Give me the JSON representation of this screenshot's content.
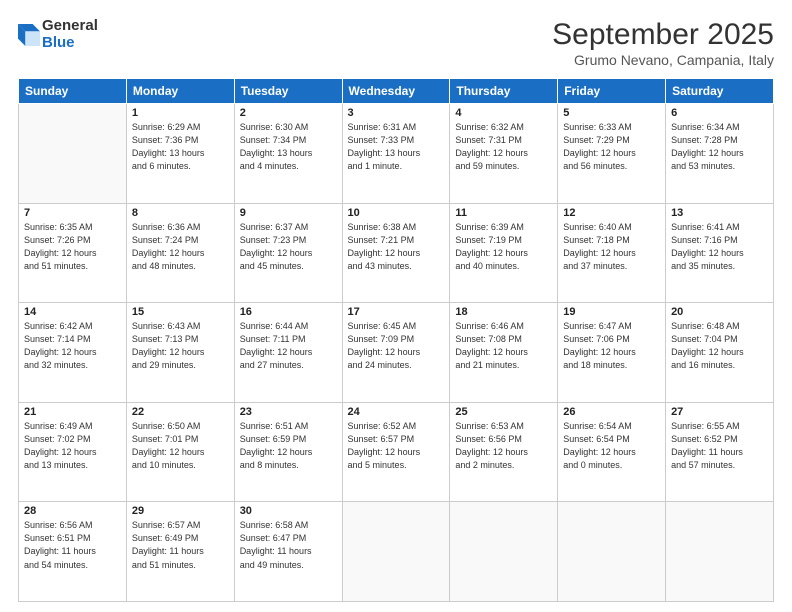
{
  "header": {
    "logo_general": "General",
    "logo_blue": "Blue",
    "month_title": "September 2025",
    "location": "Grumo Nevano, Campania, Italy"
  },
  "weekdays": [
    "Sunday",
    "Monday",
    "Tuesday",
    "Wednesday",
    "Thursday",
    "Friday",
    "Saturday"
  ],
  "weeks": [
    [
      {
        "day": "",
        "info": ""
      },
      {
        "day": "1",
        "info": "Sunrise: 6:29 AM\nSunset: 7:36 PM\nDaylight: 13 hours\nand 6 minutes."
      },
      {
        "day": "2",
        "info": "Sunrise: 6:30 AM\nSunset: 7:34 PM\nDaylight: 13 hours\nand 4 minutes."
      },
      {
        "day": "3",
        "info": "Sunrise: 6:31 AM\nSunset: 7:33 PM\nDaylight: 13 hours\nand 1 minute."
      },
      {
        "day": "4",
        "info": "Sunrise: 6:32 AM\nSunset: 7:31 PM\nDaylight: 12 hours\nand 59 minutes."
      },
      {
        "day": "5",
        "info": "Sunrise: 6:33 AM\nSunset: 7:29 PM\nDaylight: 12 hours\nand 56 minutes."
      },
      {
        "day": "6",
        "info": "Sunrise: 6:34 AM\nSunset: 7:28 PM\nDaylight: 12 hours\nand 53 minutes."
      }
    ],
    [
      {
        "day": "7",
        "info": "Sunrise: 6:35 AM\nSunset: 7:26 PM\nDaylight: 12 hours\nand 51 minutes."
      },
      {
        "day": "8",
        "info": "Sunrise: 6:36 AM\nSunset: 7:24 PM\nDaylight: 12 hours\nand 48 minutes."
      },
      {
        "day": "9",
        "info": "Sunrise: 6:37 AM\nSunset: 7:23 PM\nDaylight: 12 hours\nand 45 minutes."
      },
      {
        "day": "10",
        "info": "Sunrise: 6:38 AM\nSunset: 7:21 PM\nDaylight: 12 hours\nand 43 minutes."
      },
      {
        "day": "11",
        "info": "Sunrise: 6:39 AM\nSunset: 7:19 PM\nDaylight: 12 hours\nand 40 minutes."
      },
      {
        "day": "12",
        "info": "Sunrise: 6:40 AM\nSunset: 7:18 PM\nDaylight: 12 hours\nand 37 minutes."
      },
      {
        "day": "13",
        "info": "Sunrise: 6:41 AM\nSunset: 7:16 PM\nDaylight: 12 hours\nand 35 minutes."
      }
    ],
    [
      {
        "day": "14",
        "info": "Sunrise: 6:42 AM\nSunset: 7:14 PM\nDaylight: 12 hours\nand 32 minutes."
      },
      {
        "day": "15",
        "info": "Sunrise: 6:43 AM\nSunset: 7:13 PM\nDaylight: 12 hours\nand 29 minutes."
      },
      {
        "day": "16",
        "info": "Sunrise: 6:44 AM\nSunset: 7:11 PM\nDaylight: 12 hours\nand 27 minutes."
      },
      {
        "day": "17",
        "info": "Sunrise: 6:45 AM\nSunset: 7:09 PM\nDaylight: 12 hours\nand 24 minutes."
      },
      {
        "day": "18",
        "info": "Sunrise: 6:46 AM\nSunset: 7:08 PM\nDaylight: 12 hours\nand 21 minutes."
      },
      {
        "day": "19",
        "info": "Sunrise: 6:47 AM\nSunset: 7:06 PM\nDaylight: 12 hours\nand 18 minutes."
      },
      {
        "day": "20",
        "info": "Sunrise: 6:48 AM\nSunset: 7:04 PM\nDaylight: 12 hours\nand 16 minutes."
      }
    ],
    [
      {
        "day": "21",
        "info": "Sunrise: 6:49 AM\nSunset: 7:02 PM\nDaylight: 12 hours\nand 13 minutes."
      },
      {
        "day": "22",
        "info": "Sunrise: 6:50 AM\nSunset: 7:01 PM\nDaylight: 12 hours\nand 10 minutes."
      },
      {
        "day": "23",
        "info": "Sunrise: 6:51 AM\nSunset: 6:59 PM\nDaylight: 12 hours\nand 8 minutes."
      },
      {
        "day": "24",
        "info": "Sunrise: 6:52 AM\nSunset: 6:57 PM\nDaylight: 12 hours\nand 5 minutes."
      },
      {
        "day": "25",
        "info": "Sunrise: 6:53 AM\nSunset: 6:56 PM\nDaylight: 12 hours\nand 2 minutes."
      },
      {
        "day": "26",
        "info": "Sunrise: 6:54 AM\nSunset: 6:54 PM\nDaylight: 12 hours\nand 0 minutes."
      },
      {
        "day": "27",
        "info": "Sunrise: 6:55 AM\nSunset: 6:52 PM\nDaylight: 11 hours\nand 57 minutes."
      }
    ],
    [
      {
        "day": "28",
        "info": "Sunrise: 6:56 AM\nSunset: 6:51 PM\nDaylight: 11 hours\nand 54 minutes."
      },
      {
        "day": "29",
        "info": "Sunrise: 6:57 AM\nSunset: 6:49 PM\nDaylight: 11 hours\nand 51 minutes."
      },
      {
        "day": "30",
        "info": "Sunrise: 6:58 AM\nSunset: 6:47 PM\nDaylight: 11 hours\nand 49 minutes."
      },
      {
        "day": "",
        "info": ""
      },
      {
        "day": "",
        "info": ""
      },
      {
        "day": "",
        "info": ""
      },
      {
        "day": "",
        "info": ""
      }
    ]
  ]
}
